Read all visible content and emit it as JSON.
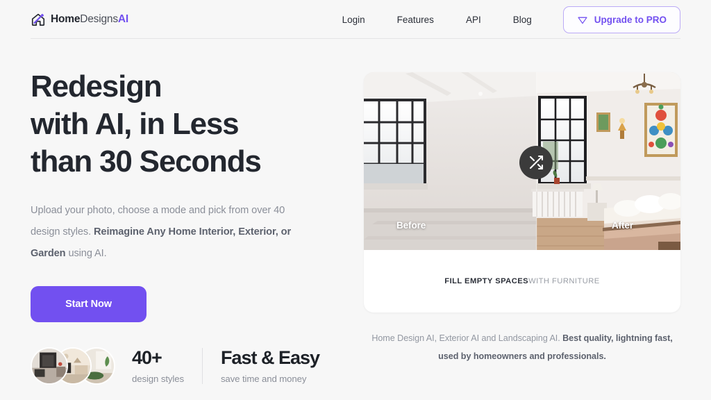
{
  "brand": {
    "part1": "Home",
    "part2": "Designs",
    "part3": "AI",
    "icon": "house-pencil-logo-icon",
    "accent": "#7250f0"
  },
  "nav": {
    "links": [
      {
        "label": "Login"
      },
      {
        "label": "Features"
      },
      {
        "label": "API"
      },
      {
        "label": "Blog"
      }
    ],
    "cta": {
      "label": "Upgrade to PRO",
      "icon": "gem-icon",
      "color": "#7250f0",
      "border": "#bbaaf6"
    }
  },
  "hero": {
    "headline_line1": "Redesign",
    "headline_line2": "with AI, in Less",
    "headline_line3": "than 30 Seconds",
    "subtitle_part1": "Upload your photo, choose a mode and pick from over 40 design styles. ",
    "subtitle_bold": "Reimagine Any Home Interior, Exterior, or Garden",
    "subtitle_part2": " using AI.",
    "cta_label": "Start Now",
    "cta_color": "#7250f0"
  },
  "stats": [
    {
      "number": "40+",
      "label": "design styles"
    },
    {
      "number": "Fast & Easy",
      "label": "save time and money"
    }
  ],
  "avatars": [
    {
      "name": "avatar-interior-dark"
    },
    {
      "name": "avatar-interior-beige"
    },
    {
      "name": "avatar-interior-green"
    }
  ],
  "showcase": {
    "before_label": "Before",
    "after_label": "After",
    "handle_icon": "shuffle-icon",
    "caption_bold": "FILL EMPTY SPACES",
    "caption_light": " WITH FURNITURE"
  },
  "tagline": {
    "light": "Home Design AI, Exterior AI and Landscaping AI. ",
    "bold": "Best quality, lightning fast, used by homeowners and professionals."
  }
}
